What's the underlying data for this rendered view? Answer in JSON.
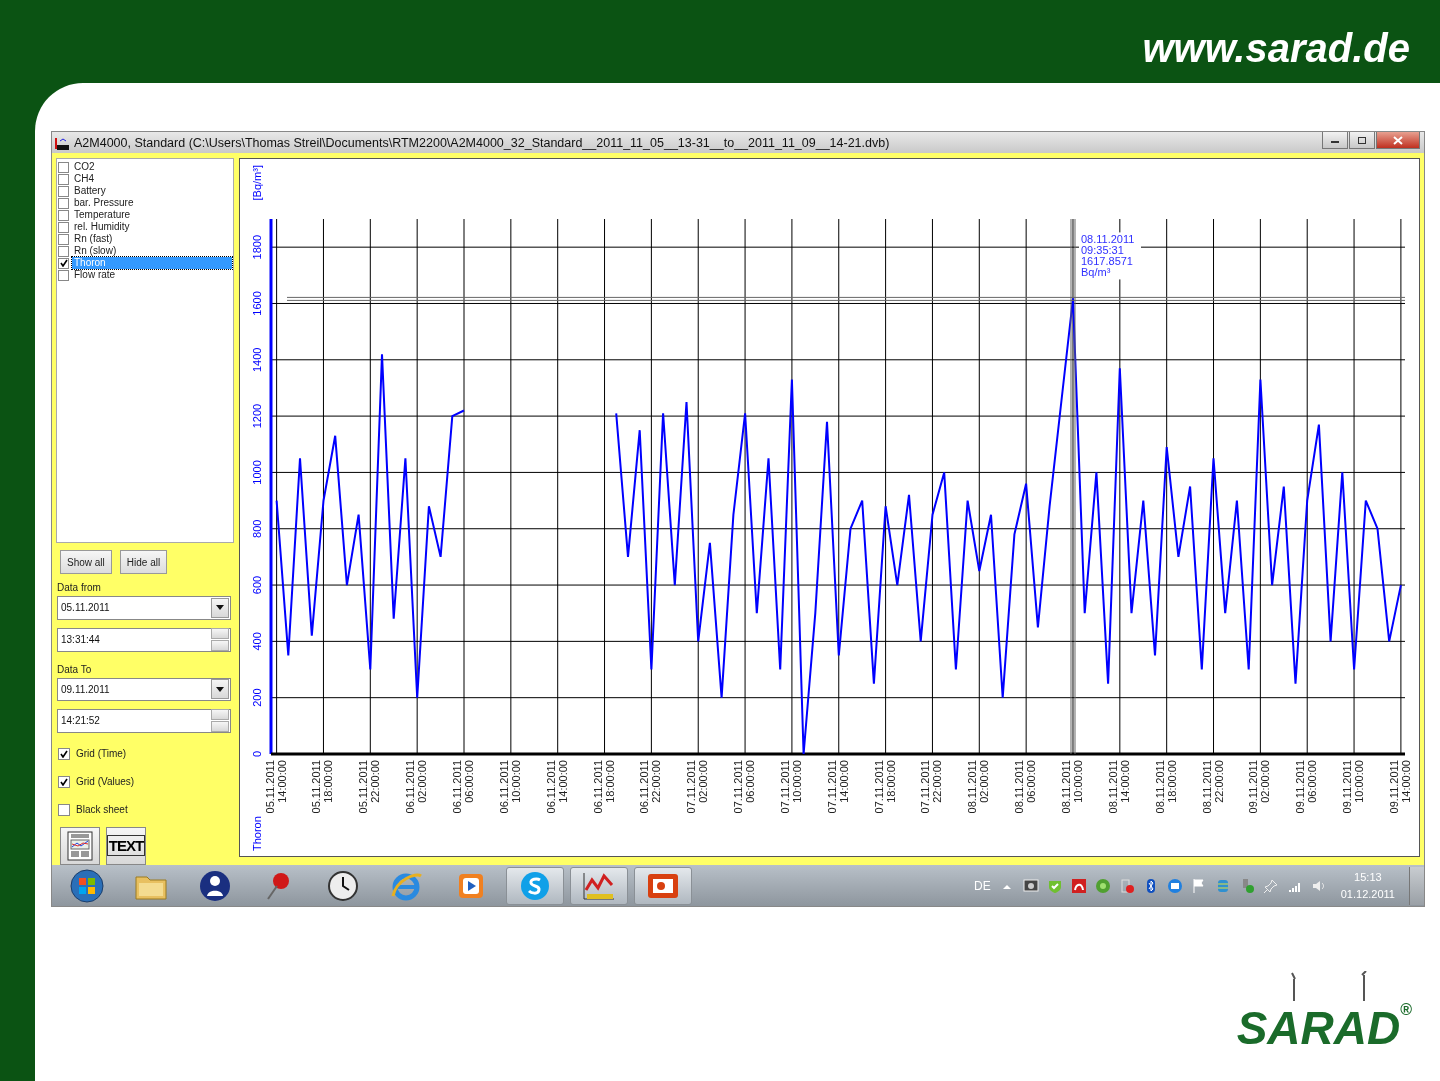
{
  "slide": {
    "website": "www.sarad.de",
    "logo": "SARAD",
    "logo_mark": "®"
  },
  "window": {
    "title": "A2M4000, Standard (C:\\Users\\Thomas Streil\\Documents\\RTM2200\\A2M4000_32_Standard__2011_11_05__13-31__to__2011_11_09__14-21.dvb)"
  },
  "channels": [
    {
      "label": "CO2",
      "checked": false,
      "selected": false
    },
    {
      "label": "CH4",
      "checked": false,
      "selected": false
    },
    {
      "label": "Battery",
      "checked": false,
      "selected": false
    },
    {
      "label": "bar. Pressure",
      "checked": false,
      "selected": false
    },
    {
      "label": "Temperature",
      "checked": false,
      "selected": false
    },
    {
      "label": "rel. Humidity",
      "checked": false,
      "selected": false
    },
    {
      "label": "Rn (fast)",
      "checked": false,
      "selected": false
    },
    {
      "label": "Rn (slow)",
      "checked": false,
      "selected": false
    },
    {
      "label": "Thoron",
      "checked": true,
      "selected": true
    },
    {
      "label": "Flow rate",
      "checked": false,
      "selected": false
    }
  ],
  "buttons": [
    "Show all",
    "Hide all"
  ],
  "ranges": [
    {
      "label": "Data from",
      "date": "05.11.2011",
      "time": "13:31:44"
    },
    {
      "label": "Data To",
      "date": "09.11.2011",
      "time": "14:21:52"
    }
  ],
  "options": [
    {
      "label": "Grid (Time)",
      "checked": true
    },
    {
      "label": "Grid (Values)",
      "checked": true
    },
    {
      "label": "Black sheet",
      "checked": false
    }
  ],
  "tool_buttons": [
    {
      "kind": "report"
    },
    {
      "kind": "text",
      "label": "TEXT"
    }
  ],
  "chart": {
    "chart_data": {
      "type": "line",
      "grid": true,
      "ylabel": "[Bq/m³]",
      "ylim": [
        0,
        1900
      ],
      "yticks": [
        0,
        200,
        400,
        600,
        800,
        1000,
        1200,
        1400,
        1600,
        1800
      ],
      "categories": [
        "05.11.2011 14:00:00",
        null,
        null,
        null,
        "05.11.2011 18:00:00",
        null,
        null,
        null,
        "05.11.2011 22:00:00",
        null,
        null,
        null,
        "06.11.2011 02:00:00",
        null,
        null,
        null,
        "06.11.2011 06:00:00",
        null,
        null,
        null,
        "06.11.2011 10:00:00",
        null,
        null,
        null,
        "06.11.2011 14:00:00",
        null,
        null,
        null,
        "06.11.2011 18:00:00",
        null,
        null,
        null,
        "06.11.2011 22:00:00",
        null,
        null,
        null,
        "07.11.2011 02:00:00",
        null,
        null,
        null,
        "07.11.2011 06:00:00",
        null,
        null,
        null,
        "07.11.2011 10:00:00",
        null,
        null,
        null,
        "07.11.2011 14:00:00",
        null,
        null,
        null,
        "07.11.2011 18:00:00",
        null,
        null,
        null,
        "07.11.2011 22:00:00",
        null,
        null,
        null,
        "08.11.2011 02:00:00",
        null,
        null,
        null,
        "08.11.2011 06:00:00",
        null,
        null,
        null,
        "08.11.2011 10:00:00",
        null,
        null,
        null,
        "08.11.2011 14:00:00",
        null,
        null,
        null,
        "08.11.2011 18:00:00",
        null,
        null,
        null,
        "08.11.2011 22:00:00",
        null,
        null,
        null,
        "09.11.2011 02:00:00",
        null,
        null,
        null,
        "09.11.2011 06:00:00",
        null,
        null,
        null,
        "09.11.2011 10:00:00",
        null,
        null,
        null,
        "09.11.2011 14:00:00"
      ],
      "series": [
        {
          "name": "Thoron",
          "color": "#0000ff",
          "values": [
            900,
            350,
            1050,
            420,
            900,
            1130,
            600,
            850,
            300,
            1420,
            480,
            1050,
            200,
            880,
            700,
            1200,
            1220,
            null,
            null,
            null,
            null,
            null,
            null,
            null,
            null,
            null,
            null,
            null,
            null,
            1210,
            700,
            1150,
            300,
            1210,
            600,
            1250,
            400,
            750,
            200,
            850,
            1210,
            500,
            1050,
            300,
            1330,
            0,
            500,
            1180,
            350,
            800,
            900,
            250,
            880,
            600,
            920,
            400,
            850,
            1000,
            300,
            900,
            650,
            850,
            200,
            780,
            960,
            450,
            880,
            1250,
            1618,
            500,
            1000,
            250,
            1370,
            500,
            900,
            350,
            1090,
            700,
            950,
            300,
            1050,
            500,
            900,
            300,
            1330,
            600,
            950,
            250,
            900,
            1170,
            400,
            1000,
            300,
            900,
            800,
            400,
            600
          ]
        }
      ],
      "annotations": [
        "08.11.2011\n09:35:31\n1617.8571\nBq/m³"
      ]
    }
  },
  "taskbar": {
    "apps": [
      {
        "kind": "start",
        "open": false
      },
      {
        "kind": "folder",
        "open": false
      },
      {
        "kind": "user",
        "open": false
      },
      {
        "kind": "pin",
        "open": false
      },
      {
        "kind": "clock",
        "open": false
      },
      {
        "kind": "browser",
        "open": false
      },
      {
        "kind": "media",
        "open": false
      },
      {
        "kind": "chat",
        "open": true
      },
      {
        "kind": "chart-app",
        "open": true
      },
      {
        "kind": "slides",
        "open": true
      }
    ],
    "language": "DE",
    "time": "15:13",
    "date": "01.12.2011"
  }
}
